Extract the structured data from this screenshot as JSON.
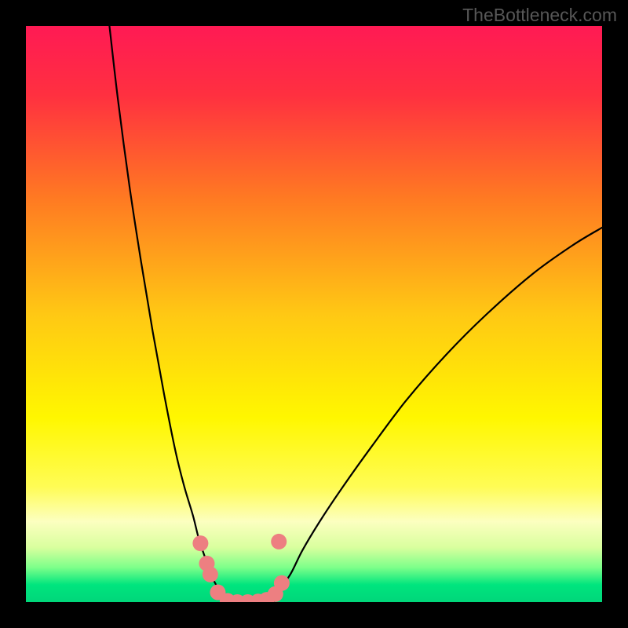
{
  "watermark": "TheBottleneck.com",
  "chart_data": {
    "type": "line",
    "title": "",
    "xlabel": "",
    "ylabel": "",
    "xlim": [
      0,
      100
    ],
    "ylim": [
      0,
      100
    ],
    "gradient_stops": [
      {
        "offset": 0.0,
        "color": "#ff1a54"
      },
      {
        "offset": 0.12,
        "color": "#ff3040"
      },
      {
        "offset": 0.3,
        "color": "#ff7a22"
      },
      {
        "offset": 0.5,
        "color": "#ffc814"
      },
      {
        "offset": 0.68,
        "color": "#fff700"
      },
      {
        "offset": 0.8,
        "color": "#fffc55"
      },
      {
        "offset": 0.86,
        "color": "#fcffc0"
      },
      {
        "offset": 0.905,
        "color": "#d9ff9e"
      },
      {
        "offset": 0.94,
        "color": "#7dff8a"
      },
      {
        "offset": 0.97,
        "color": "#00e57e"
      },
      {
        "offset": 1.0,
        "color": "#00d67a"
      }
    ],
    "green_band": {
      "y_start": 93,
      "y_end": 100
    },
    "series": [
      {
        "name": "left-branch",
        "x": [
          14.5,
          16,
          18,
          20,
          22,
          24,
          26,
          27.5,
          29,
          30,
          31,
          32,
          33,
          33.5,
          34.0,
          34.5
        ],
        "y": [
          0,
          13,
          28,
          41,
          53,
          64,
          74,
          80,
          85,
          89,
          92,
          95,
          97,
          98,
          99.2,
          100
        ]
      },
      {
        "name": "right-branch",
        "x": [
          43.0,
          44,
          46,
          48,
          51,
          55,
          60,
          66,
          73,
          80,
          88,
          95,
          100
        ],
        "y": [
          100,
          98,
          95,
          91,
          86,
          80,
          73,
          65,
          57,
          50,
          43,
          38,
          35
        ]
      },
      {
        "name": "valley-floor",
        "x": [
          34.5,
          36,
          38,
          40,
          42,
          43.0
        ],
        "y": [
          100,
          100,
          100,
          100,
          100,
          100
        ]
      }
    ],
    "markers": [
      {
        "x": 30.3,
        "y": 89.8
      },
      {
        "x": 31.4,
        "y": 93.3
      },
      {
        "x": 32.0,
        "y": 95.2
      },
      {
        "x": 33.3,
        "y": 98.3
      },
      {
        "x": 35.0,
        "y": 99.8
      },
      {
        "x": 36.7,
        "y": 100.0
      },
      {
        "x": 38.5,
        "y": 100.0
      },
      {
        "x": 40.3,
        "y": 99.9
      },
      {
        "x": 41.8,
        "y": 99.6
      },
      {
        "x": 43.3,
        "y": 98.6
      },
      {
        "x": 44.4,
        "y": 96.7
      },
      {
        "x": 43.9,
        "y": 89.5
      }
    ],
    "marker_color": "#ed7f81",
    "marker_radius": 10,
    "curve_color": "#000000",
    "curve_width": 2.2
  }
}
